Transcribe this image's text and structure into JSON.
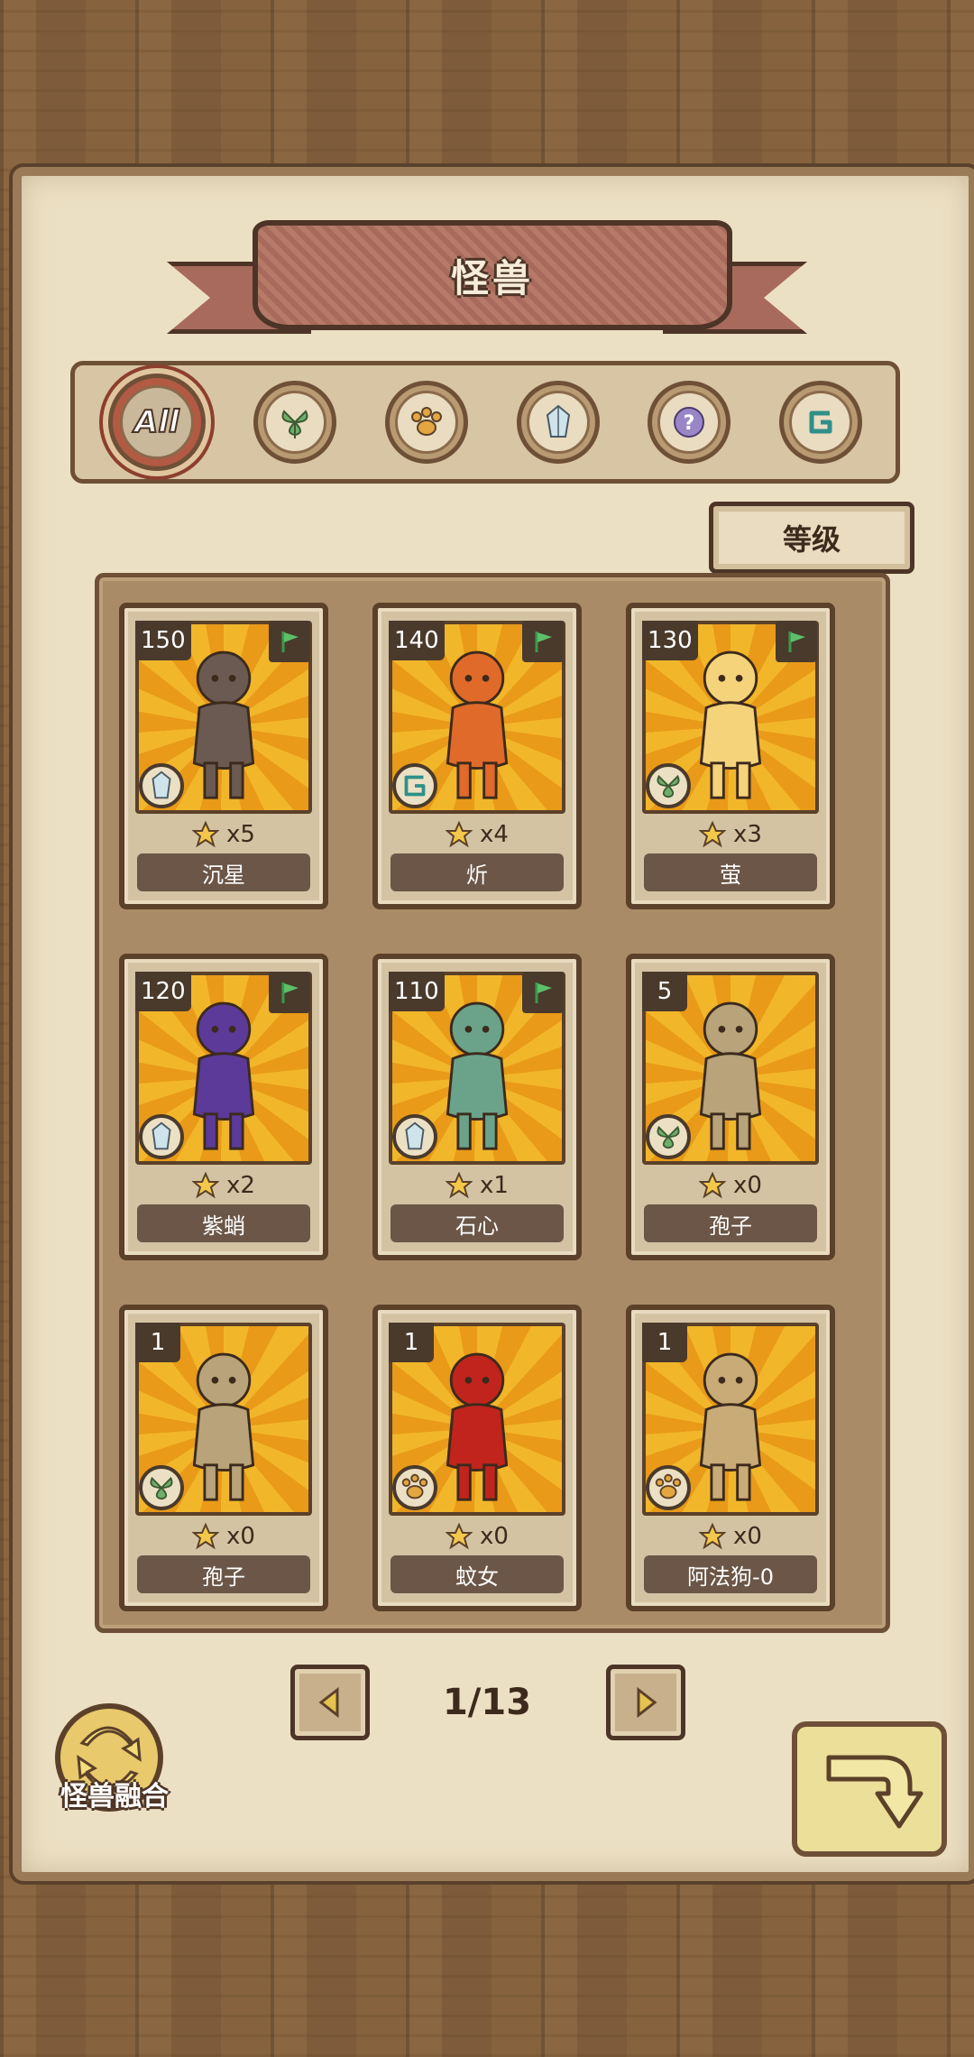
{
  "title": "怪兽",
  "filters": [
    {
      "id": "all",
      "label": "All",
      "icon": "all-text",
      "active": true
    },
    {
      "id": "plant",
      "icon": "leaf-icon"
    },
    {
      "id": "beast",
      "icon": "paw-icon"
    },
    {
      "id": "mineral",
      "icon": "crystal-icon"
    },
    {
      "id": "unknown",
      "icon": "question-icon"
    },
    {
      "id": "element",
      "icon": "spiral-icon"
    }
  ],
  "sort_label": "等级",
  "cards": [
    {
      "level": "150",
      "stars": "x5",
      "name": "沉星",
      "type": "crystal-icon",
      "flag": true,
      "color": "#6a5a52"
    },
    {
      "level": "140",
      "stars": "x4",
      "name": "炘",
      "type": "spiral-icon",
      "flag": true,
      "color": "#e06a2a"
    },
    {
      "level": "130",
      "stars": "x3",
      "name": "萤",
      "type": "leaf-icon",
      "flag": true,
      "color": "#f4d37a"
    },
    {
      "level": "120",
      "stars": "x2",
      "name": "紫蛸",
      "type": "crystal-icon",
      "flag": true,
      "color": "#5b3a9a"
    },
    {
      "level": "110",
      "stars": "x1",
      "name": "石心",
      "type": "crystal-icon",
      "flag": true,
      "color": "#6aa38a"
    },
    {
      "level": "5",
      "stars": "x0",
      "name": "孢子",
      "type": "leaf-icon",
      "flag": false,
      "color": "#b8a37a"
    },
    {
      "level": "1",
      "stars": "x0",
      "name": "孢子",
      "type": "leaf-icon",
      "flag": false,
      "color": "#b8a37a"
    },
    {
      "level": "1",
      "stars": "x0",
      "name": "蚊女",
      "type": "paw-icon",
      "flag": false,
      "color": "#c0241c"
    },
    {
      "level": "1",
      "stars": "x0",
      "name": "阿法狗-0",
      "type": "paw-icon",
      "flag": false,
      "color": "#c9ab78"
    }
  ],
  "pagination": {
    "label": "1/13"
  },
  "fusion_label": "怪兽融合"
}
